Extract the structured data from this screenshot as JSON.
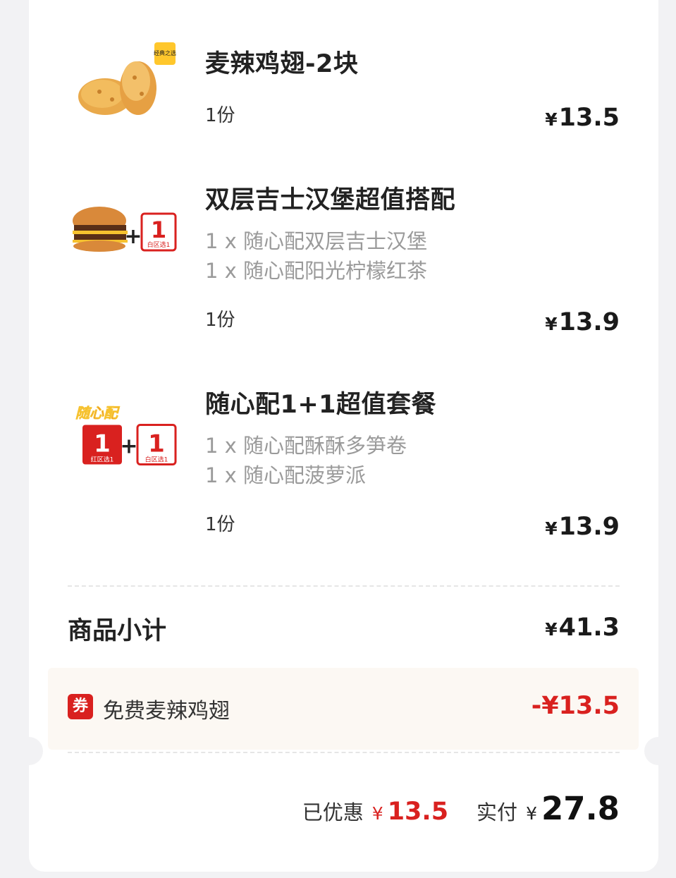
{
  "currency_symbol": "¥",
  "items": [
    {
      "name": "麦辣鸡翅-2块",
      "badge": "经典之选",
      "details": [],
      "qty": "1份",
      "price": "13.5"
    },
    {
      "name": "双层吉士汉堡超值搭配",
      "badge_plus": "+",
      "badge_num": "1",
      "badge_sub": "白区选1",
      "details": [
        "1 x 随心配双层吉士汉堡",
        "1 x 随心配阳光柠檬红茶"
      ],
      "qty": "1份",
      "price": "13.9"
    },
    {
      "name": "随心配1+1超值套餐",
      "badge_title": "随心配",
      "badge_left_num": "1",
      "badge_left_sub": "红区选1",
      "badge_plus": "+",
      "badge_right_num": "1",
      "badge_right_sub": "白区选1",
      "details": [
        "1 x 随心配酥酥多笋卷",
        "1 x 随心配菠萝派"
      ],
      "qty": "1份",
      "price": "13.9"
    }
  ],
  "subtotal": {
    "label": "商品小计",
    "value": "41.3"
  },
  "coupon": {
    "icon_text": "券",
    "label": "免费麦辣鸡翅",
    "value": "-¥13.5"
  },
  "totals": {
    "discount_label": "已优惠",
    "discount_value": "13.5",
    "paid_label": "实付",
    "paid_value": "27.8"
  },
  "colors": {
    "accent_red": "#d9211f",
    "coupon_bg": "#fcf8f3",
    "page_bg": "#f2f2f4"
  }
}
